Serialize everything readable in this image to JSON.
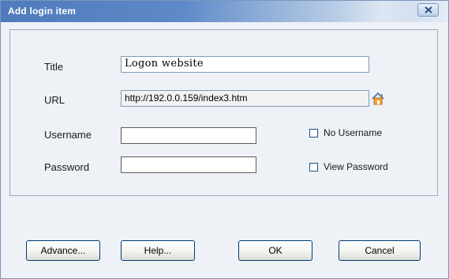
{
  "window": {
    "title": "Add login item",
    "close_icon": "close-x-icon"
  },
  "form": {
    "title_label": "Title",
    "title_value": "Logon website",
    "url_label": "URL",
    "url_value": "http://192.0.0.159/index3.htm",
    "url_icon": "home-icon",
    "username_label": "Username",
    "username_value": "",
    "password_label": "Password",
    "password_value": "",
    "no_username_label": "No Username",
    "no_username_checked": false,
    "view_password_label": "View Password",
    "view_password_checked": false
  },
  "buttons": {
    "advance": "Advance...",
    "help": "Help...",
    "ok": "OK",
    "cancel": "Cancel"
  }
}
